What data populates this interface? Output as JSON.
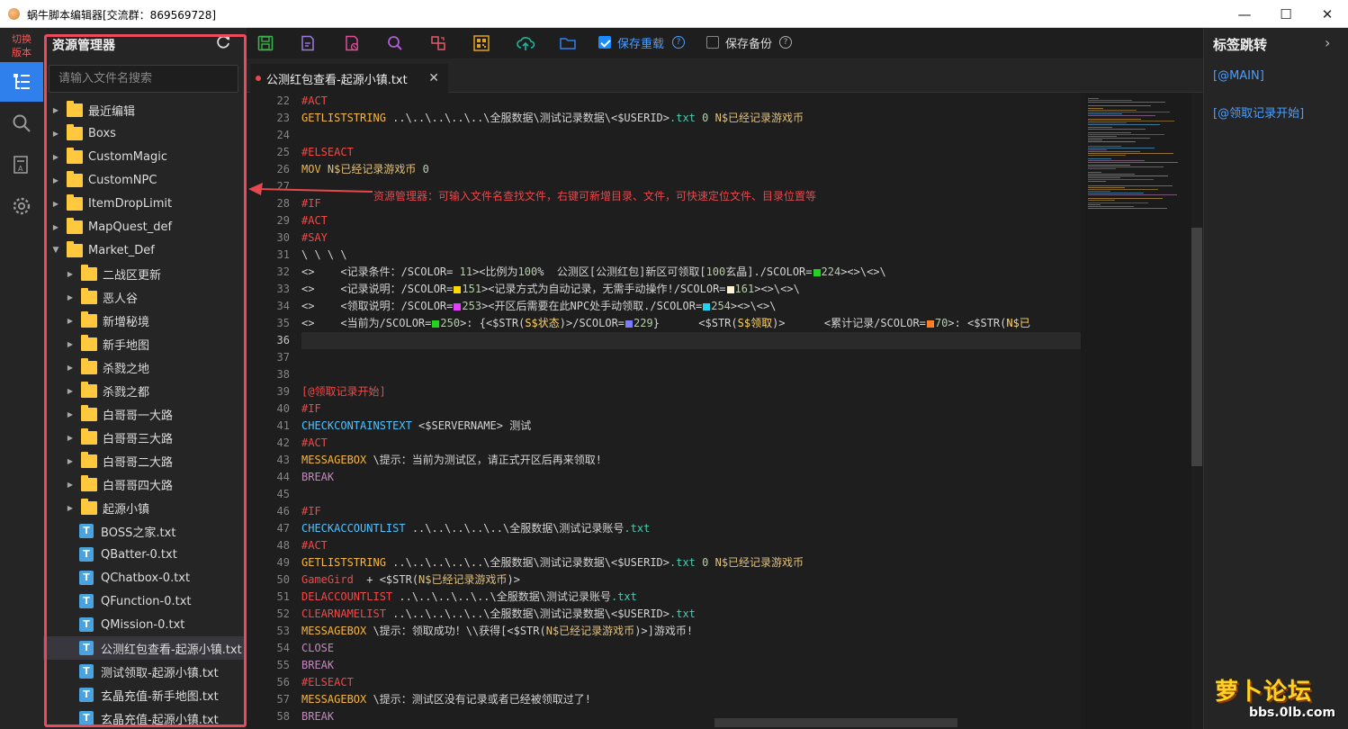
{
  "window": {
    "title": "蜗牛脚本编辑器[交流群：869569728]",
    "minimize": "—",
    "maximize": "☐",
    "close": "✕"
  },
  "activity": {
    "switch_label_1": "切换",
    "switch_label_2": "版本"
  },
  "explorer": {
    "title": "资源管理器",
    "search_placeholder": "请输入文件名搜索",
    "tree": [
      {
        "label": "最近编辑",
        "type": "folder",
        "depth": 0,
        "expanded": false
      },
      {
        "label": "Boxs",
        "type": "folder",
        "depth": 0,
        "expanded": false
      },
      {
        "label": "CustomMagic",
        "type": "folder",
        "depth": 0,
        "expanded": false
      },
      {
        "label": "CustomNPC",
        "type": "folder",
        "depth": 0,
        "expanded": false
      },
      {
        "label": "ItemDropLimit",
        "type": "folder",
        "depth": 0,
        "expanded": false
      },
      {
        "label": "MapQuest_def",
        "type": "folder",
        "depth": 0,
        "expanded": false
      },
      {
        "label": "Market_Def",
        "type": "folder",
        "depth": 0,
        "expanded": true
      },
      {
        "label": "二战区更新",
        "type": "folder",
        "depth": 1,
        "expanded": false
      },
      {
        "label": "恶人谷",
        "type": "folder",
        "depth": 1,
        "expanded": false
      },
      {
        "label": "新增秘境",
        "type": "folder",
        "depth": 1,
        "expanded": false
      },
      {
        "label": "新手地图",
        "type": "folder",
        "depth": 1,
        "expanded": false
      },
      {
        "label": "杀戮之地",
        "type": "folder",
        "depth": 1,
        "expanded": false
      },
      {
        "label": "杀戮之都",
        "type": "folder",
        "depth": 1,
        "expanded": false
      },
      {
        "label": "白哥哥一大路",
        "type": "folder",
        "depth": 1,
        "expanded": false
      },
      {
        "label": "白哥哥三大路",
        "type": "folder",
        "depth": 1,
        "expanded": false
      },
      {
        "label": "白哥哥二大路",
        "type": "folder",
        "depth": 1,
        "expanded": false
      },
      {
        "label": "白哥哥四大路",
        "type": "folder",
        "depth": 1,
        "expanded": false
      },
      {
        "label": "起源小镇",
        "type": "folder",
        "depth": 1,
        "expanded": false
      },
      {
        "label": "BOSS之家.txt",
        "type": "file",
        "depth": 1
      },
      {
        "label": "QBatter-0.txt",
        "type": "file",
        "depth": 1
      },
      {
        "label": "QChatbox-0.txt",
        "type": "file",
        "depth": 1
      },
      {
        "label": "QFunction-0.txt",
        "type": "file",
        "depth": 1
      },
      {
        "label": "QMission-0.txt",
        "type": "file",
        "depth": 1
      },
      {
        "label": "公测红包查看-起源小镇.txt",
        "type": "file",
        "depth": 1,
        "selected": true
      },
      {
        "label": "测试领取-起源小镇.txt",
        "type": "file",
        "depth": 1
      },
      {
        "label": "玄晶充值-新手地图.txt",
        "type": "file",
        "depth": 1
      },
      {
        "label": "玄晶充值-起源小镇.txt",
        "type": "file",
        "depth": 1
      }
    ]
  },
  "toolbar": {
    "save_reload_label": "保存重载",
    "save_reload_checked": true,
    "save_backup_label": "保存备份",
    "save_backup_checked": false
  },
  "tabs": [
    {
      "label": "公测红包查看-起源小镇.txt",
      "modified": true,
      "close": "✕"
    }
  ],
  "annotation": "资源管理器：可输入文件名查找文件，右键可新增目录、文件，可快速定位文件、目录位置等",
  "bookmarks": {
    "title": "标签跳转",
    "chevron": "›",
    "items": [
      "[@MAIN]",
      "[@领取记录开始]"
    ]
  },
  "colors": {
    "accent": "#2f80ed",
    "highlight_border": "#ea4a5c",
    "bookmark_link": "#4a9eff"
  },
  "watermark": {
    "main": "萝卜论坛",
    "sub": "bbs.0lb.com"
  },
  "editor": {
    "current_line": 36,
    "lines": [
      {
        "n": 22,
        "tokens": [
          {
            "t": "#ACT",
            "c": "k4"
          }
        ]
      },
      {
        "n": 23,
        "tokens": [
          {
            "t": "GETLISTSTRING",
            "c": "kw"
          },
          {
            "t": " ..\\..\\..\\..\\..\\全服数据\\测试记录数据\\<$USERID>"
          },
          {
            "t": ".txt",
            "c": "k6"
          },
          {
            "t": " 0 ",
            "c": "num"
          },
          {
            "t": "N$已经记录游戏币",
            "c": "str"
          }
        ]
      },
      {
        "n": 24,
        "tokens": []
      },
      {
        "n": 25,
        "tokens": [
          {
            "t": "#ELSEACT",
            "c": "k4"
          }
        ]
      },
      {
        "n": 26,
        "tokens": [
          {
            "t": "MOV",
            "c": "kw"
          },
          {
            "t": " N$已经记录游戏币",
            "c": "str"
          },
          {
            "t": " 0",
            "c": "num"
          }
        ]
      },
      {
        "n": 27,
        "tokens": []
      },
      {
        "n": 28,
        "tokens": [
          {
            "t": "#IF",
            "c": "k4"
          }
        ]
      },
      {
        "n": 29,
        "tokens": [
          {
            "t": "#ACT",
            "c": "k4"
          }
        ]
      },
      {
        "n": 30,
        "tokens": [
          {
            "t": "#SAY",
            "c": "k4"
          }
        ]
      },
      {
        "n": 31,
        "tokens": [
          {
            "t": "\\ \\ \\ \\"
          }
        ]
      },
      {
        "n": 32,
        "tokens": [
          {
            "t": "<>    <记录条件：/SCOLOR= "
          },
          {
            "t": "11",
            "c": "num"
          },
          {
            "t": "><比例为"
          },
          {
            "t": "100",
            "c": "num"
          },
          {
            "t": "%  公测区[公测红包]新区可领取["
          },
          {
            "t": "100",
            "c": "num"
          },
          {
            "t": "玄晶]./SCOLOR="
          },
          {
            "sw": "#1fd31f"
          },
          {
            "t": "224",
            "c": "num"
          },
          {
            "t": "><>\\<>\\"
          }
        ]
      },
      {
        "n": 33,
        "tokens": [
          {
            "t": "<>    <记录说明：/SCOLOR="
          },
          {
            "sw": "#ffd700"
          },
          {
            "t": "151",
            "c": "num"
          },
          {
            "t": "><记录方式为自动记录，无需手动操作!/SCOLOR="
          },
          {
            "sw": "#fff3d6"
          },
          {
            "t": "161",
            "c": "num"
          },
          {
            "t": "><>\\<>\\"
          }
        ]
      },
      {
        "n": 34,
        "tokens": [
          {
            "t": "<>    <领取说明：/SCOLOR="
          },
          {
            "sw": "#e040fb"
          },
          {
            "t": "253",
            "c": "num"
          },
          {
            "t": "><开区后需要在此NPC处手动领取./SCOLOR="
          },
          {
            "sw": "#22d3ee"
          },
          {
            "t": "254",
            "c": "num"
          },
          {
            "t": "><>\\<>\\"
          }
        ]
      },
      {
        "n": 35,
        "tokens": [
          {
            "t": "<>    <当前为/SCOLOR="
          },
          {
            "sw": "#1fd31f"
          },
          {
            "t": "250",
            "c": "num"
          },
          {
            "t": ">: {<$STR("
          },
          {
            "t": "S$状态",
            "c": "sub"
          },
          {
            "t": ")>/SCOLOR="
          },
          {
            "sw": "#7b7bff"
          },
          {
            "t": "229",
            "c": "num"
          },
          {
            "t": "}      <$STR("
          },
          {
            "t": "S$领取",
            "c": "sub"
          },
          {
            "t": ")>      <累计记录/SCOLOR="
          },
          {
            "sw": "#ff7f27"
          },
          {
            "t": "70",
            "c": "num"
          },
          {
            "t": ">: <$STR("
          },
          {
            "t": "N$已",
            "c": "sub"
          }
        ]
      },
      {
        "n": 36,
        "tokens": []
      },
      {
        "n": 37,
        "tokens": []
      },
      {
        "n": 38,
        "tokens": []
      },
      {
        "n": 39,
        "tokens": [
          {
            "t": "[@领取记录开始]",
            "c": "k4"
          }
        ]
      },
      {
        "n": 40,
        "tokens": [
          {
            "t": "#IF",
            "c": "k4"
          }
        ]
      },
      {
        "n": 41,
        "tokens": [
          {
            "t": "CHECKCONTAINSTEXT",
            "c": "k3"
          },
          {
            "t": " <$SERVERNAME> 测试"
          }
        ]
      },
      {
        "n": 42,
        "tokens": [
          {
            "t": "#ACT",
            "c": "k4"
          }
        ]
      },
      {
        "n": 43,
        "tokens": [
          {
            "t": "MESSAGEBOX",
            "c": "kw"
          },
          {
            "t": " \\提示：当前为测试区，请正式开区后再来领取!"
          }
        ]
      },
      {
        "n": 44,
        "tokens": [
          {
            "t": "BREAK",
            "c": "k2"
          }
        ]
      },
      {
        "n": 45,
        "tokens": []
      },
      {
        "n": 46,
        "tokens": [
          {
            "t": "#IF",
            "c": "k4"
          }
        ]
      },
      {
        "n": 47,
        "tokens": [
          {
            "t": "CHECKACCOUNTLIST",
            "c": "k3"
          },
          {
            "t": " ..\\..\\..\\..\\..\\全服数据\\测试记录账号"
          },
          {
            "t": ".txt",
            "c": "k6"
          }
        ]
      },
      {
        "n": 48,
        "tokens": [
          {
            "t": "#ACT",
            "c": "k4"
          }
        ]
      },
      {
        "n": 49,
        "tokens": [
          {
            "t": "GETLISTSTRING",
            "c": "kw"
          },
          {
            "t": " ..\\..\\..\\..\\..\\全服数据\\测试记录数据\\<$USERID>"
          },
          {
            "t": ".txt",
            "c": "k6"
          },
          {
            "t": " 0 ",
            "c": "num"
          },
          {
            "t": "N$已经记录游戏币",
            "c": "str"
          }
        ]
      },
      {
        "n": 50,
        "tokens": [
          {
            "t": "GameGird",
            "c": "k4"
          },
          {
            "t": "  + <$STR("
          },
          {
            "t": "N$已经记录游戏币",
            "c": "str"
          },
          {
            "t": ")>"
          }
        ]
      },
      {
        "n": 51,
        "tokens": [
          {
            "t": "DELACCOUNTLIST",
            "c": "k4"
          },
          {
            "t": " ..\\..\\..\\..\\..\\全服数据\\测试记录账号"
          },
          {
            "t": ".txt",
            "c": "k6"
          }
        ]
      },
      {
        "n": 52,
        "tokens": [
          {
            "t": "CLEARNAMELIST",
            "c": "k4"
          },
          {
            "t": " ..\\..\\..\\..\\..\\全服数据\\测试记录数据\\<$USERID>"
          },
          {
            "t": ".txt",
            "c": "k6"
          }
        ]
      },
      {
        "n": 53,
        "tokens": [
          {
            "t": "MESSAGEBOX",
            "c": "kw"
          },
          {
            "t": " \\提示：领取成功！\\\\获得[<$STR("
          },
          {
            "t": "N$已经记录游戏币",
            "c": "str"
          },
          {
            "t": ")>]游戏币!"
          }
        ]
      },
      {
        "n": 54,
        "tokens": [
          {
            "t": "CLOSE",
            "c": "k2"
          }
        ]
      },
      {
        "n": 55,
        "tokens": [
          {
            "t": "BREAK",
            "c": "k2"
          }
        ]
      },
      {
        "n": 56,
        "tokens": [
          {
            "t": "#ELSEACT",
            "c": "k4"
          }
        ]
      },
      {
        "n": 57,
        "tokens": [
          {
            "t": "MESSAGEBOX",
            "c": "kw"
          },
          {
            "t": " \\提示：测试区没有记录或者已经被领取过了!"
          }
        ]
      },
      {
        "n": 58,
        "tokens": [
          {
            "t": "BREAK",
            "c": "k2"
          }
        ]
      }
    ]
  }
}
